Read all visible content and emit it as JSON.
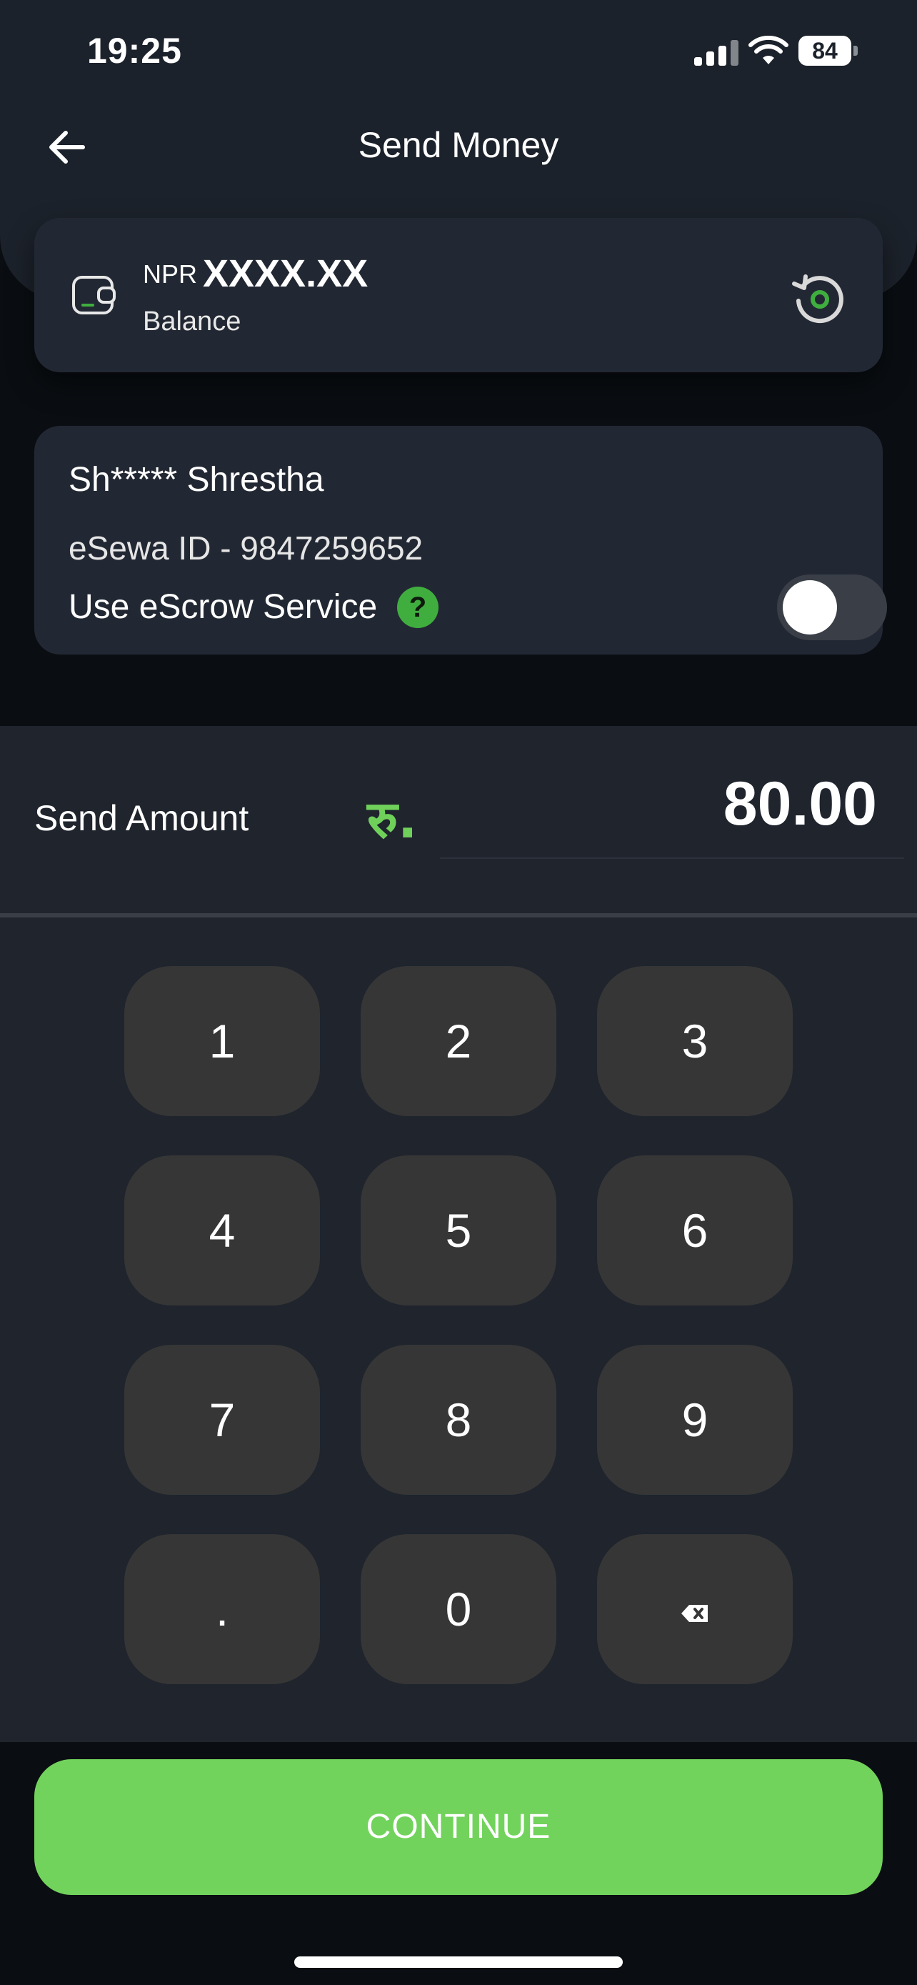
{
  "status_bar": {
    "time": "19:25",
    "battery": "84"
  },
  "header": {
    "title": "Send Money"
  },
  "balance": {
    "currency": "NPR",
    "value": "XXXX.XX",
    "label": "Balance"
  },
  "recipient": {
    "name": "Sh***** Shrestha",
    "esewa_id": "eSewa ID - 9847259652",
    "escrow_label": "Use eScrow Service",
    "escrow_help": "?",
    "escrow_enabled": false
  },
  "amount": {
    "label": "Send Amount",
    "currency_symbol": "रु.",
    "value": "80.00"
  },
  "keypad": {
    "keys": [
      "1",
      "2",
      "3",
      "4",
      "5",
      "6",
      "7",
      "8",
      "9",
      ".",
      "0"
    ],
    "backspace_icon": "backspace-icon"
  },
  "actions": {
    "continue_label": "CONTINUE"
  },
  "colors": {
    "accent": "#72d35c",
    "card": "#222833",
    "keypad_key": "#363636"
  }
}
